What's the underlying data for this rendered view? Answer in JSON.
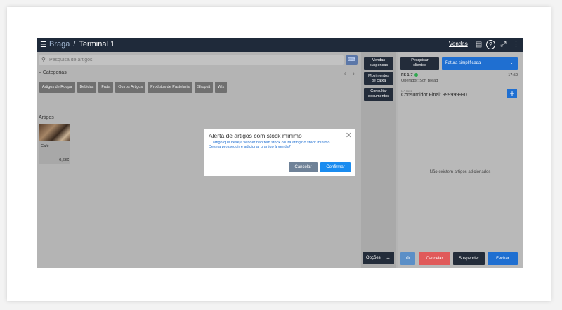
{
  "topbar": {
    "menu_icon": "hamburger-icon",
    "store": "Braga",
    "separator": "/",
    "terminal": "Terminal 1",
    "vendas": "Vendas",
    "icons": [
      "cash-register-icon",
      "help-icon",
      "fullscreen-icon",
      "more-icon"
    ]
  },
  "search": {
    "placeholder": "Pesquisa de artigos"
  },
  "categories": {
    "title": "Categorias",
    "items": [
      "Artigos de Roupa",
      "Bebidas",
      "Fruta",
      "Outros Artigos",
      "Produtos de Pastelaria",
      "Shopkit",
      "Wix"
    ]
  },
  "articles": {
    "title": "Artigos",
    "items": [
      {
        "name": "Café",
        "price": "0,63€"
      }
    ]
  },
  "middle": {
    "buttons": [
      "Vendas\nsuspensas",
      "Movimentos\nde caixa",
      "Consultar\ndocumentos"
    ],
    "options": "Opções"
  },
  "right": {
    "search_clients": "Pesquisar\nclientes",
    "doc_type": "Fatura simplificada",
    "doc_number": "FS 1-7",
    "time": "17:50",
    "operator": "Operador: Soft Bread",
    "nif_label": "N.º 9999",
    "customer": "Consumidor Final: 999999990",
    "empty": "Não existem artigos adicionados",
    "buttons": {
      "cancel": "Cancelar",
      "suspend": "Suspender",
      "close": "Fechar"
    }
  },
  "modal": {
    "title": "Alerta de artigos com stock mínimo",
    "line1": "O artigo que deseja vender não tem stock ou irá atingir o stock mínimo.",
    "line2": "Deseja prosseguir e adicionar o artigo à venda?",
    "cancel": "Cancelar",
    "confirm": "Confirmar"
  },
  "colors": {
    "topbar": "#1f2a3a",
    "accent": "#1f6fd1",
    "confirm": "#1a8cf0",
    "cancel_red": "#e05a5a"
  }
}
